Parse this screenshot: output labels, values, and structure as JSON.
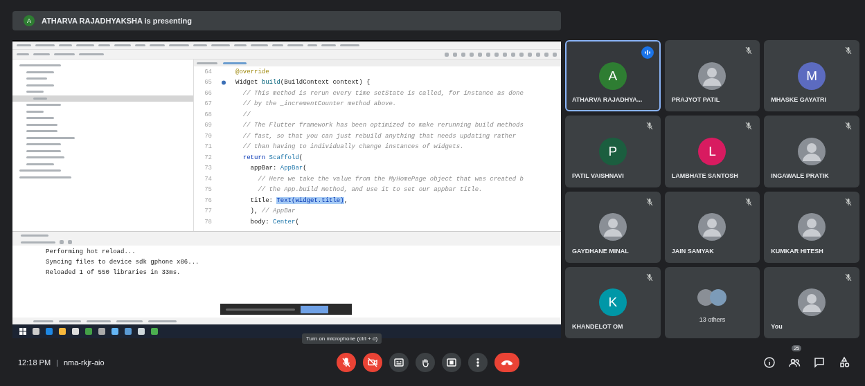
{
  "presenter_bar": {
    "initial": "A",
    "text": "ATHARVA RAJADHYAKSHA is presenting"
  },
  "shared_screen": {
    "editor": {
      "lines": [
        {
          "num": "64",
          "marker": false,
          "segments": [
            {
              "kind": "annotation",
              "text": "@override"
            }
          ]
        },
        {
          "num": "65",
          "marker": true,
          "segments": [
            {
              "kind": "code",
              "text": "Widget "
            },
            {
              "kind": "method",
              "text": "build"
            },
            {
              "kind": "code",
              "text": "(BuildContext context) {"
            }
          ]
        },
        {
          "num": "66",
          "marker": false,
          "segments": [
            {
              "kind": "comment",
              "text": "  // This method is rerun every time setState is called, for instance as done"
            }
          ]
        },
        {
          "num": "67",
          "marker": false,
          "segments": [
            {
              "kind": "comment",
              "text": "  // by the _incrementCounter method above."
            }
          ]
        },
        {
          "num": "68",
          "marker": false,
          "segments": [
            {
              "kind": "comment",
              "text": "  //"
            }
          ]
        },
        {
          "num": "69",
          "marker": false,
          "segments": [
            {
              "kind": "comment",
              "text": "  // The Flutter framework has been optimized to make rerunning build methods"
            }
          ]
        },
        {
          "num": "70",
          "marker": false,
          "segments": [
            {
              "kind": "comment",
              "text": "  // fast, so that you can just rebuild anything that needs updating rather"
            }
          ]
        },
        {
          "num": "71",
          "marker": false,
          "segments": [
            {
              "kind": "comment",
              "text": "  // than having to individually change instances of widgets."
            }
          ]
        },
        {
          "num": "72",
          "marker": false,
          "segments": [
            {
              "kind": "keyword",
              "text": "  return "
            },
            {
              "kind": "class",
              "text": "Scaffold"
            },
            {
              "kind": "code",
              "text": "("
            }
          ]
        },
        {
          "num": "73",
          "marker": false,
          "segments": [
            {
              "kind": "code",
              "text": "    appBar: "
            },
            {
              "kind": "class",
              "text": "AppBar"
            },
            {
              "kind": "code",
              "text": "("
            }
          ]
        },
        {
          "num": "74",
          "marker": false,
          "segments": [
            {
              "kind": "comment",
              "text": "      // Here we take the value from the MyHomePage object that was created b"
            }
          ]
        },
        {
          "num": "75",
          "marker": false,
          "segments": [
            {
              "kind": "comment",
              "text": "      // the App.build method, and use it to set our appbar title."
            }
          ]
        },
        {
          "num": "76",
          "marker": false,
          "segments": [
            {
              "kind": "code",
              "text": "    title: "
            },
            {
              "kind": "selection",
              "text": "Text(widget.title)"
            },
            {
              "kind": "code",
              "text": ","
            }
          ]
        },
        {
          "num": "77",
          "marker": false,
          "segments": [
            {
              "kind": "code",
              "text": "    ), "
            },
            {
              "kind": "comment",
              "text": "// AppBar"
            }
          ]
        },
        {
          "num": "78",
          "marker": false,
          "segments": [
            {
              "kind": "code",
              "text": "    body: "
            },
            {
              "kind": "class",
              "text": "Center"
            },
            {
              "kind": "code",
              "text": "("
            }
          ]
        }
      ]
    },
    "console": [
      "Performing hot reload...",
      "Syncing files to device sdk gphone x86...",
      "Reloaded 1 of 550 libraries in 33ms."
    ]
  },
  "participants": [
    {
      "name": "ATHARVA RAJADHYA...",
      "kind": "initial",
      "initial": "A",
      "color": "#2e7d32",
      "speaking": true,
      "muted": false
    },
    {
      "name": "PRAJYOT PATIL",
      "kind": "photo",
      "speaking": false,
      "muted": true
    },
    {
      "name": "MHASKE GAYATRI",
      "kind": "initial",
      "initial": "M",
      "color": "#5c6bc0",
      "speaking": false,
      "muted": true
    },
    {
      "name": "PATIL VAISHNAVI",
      "kind": "initial",
      "initial": "P",
      "color": "#1b5e3f",
      "speaking": false,
      "muted": true
    },
    {
      "name": "LAMBHATE SANTOSH",
      "kind": "initial",
      "initial": "L",
      "color": "#d81b60",
      "speaking": false,
      "muted": true
    },
    {
      "name": "INGAWALE PRATIK",
      "kind": "photo",
      "speaking": false,
      "muted": true
    },
    {
      "name": "GAYDHANE MINAL",
      "kind": "photo",
      "speaking": false,
      "muted": true
    },
    {
      "name": "JAIN SAMYAK",
      "kind": "photo",
      "speaking": false,
      "muted": true
    },
    {
      "name": "KUMKAR HITESH",
      "kind": "photo",
      "speaking": false,
      "muted": true
    },
    {
      "name": "KHANDELOT OM",
      "kind": "initial",
      "initial": "K",
      "color": "#0097a7",
      "speaking": false,
      "muted": true
    },
    {
      "name": "13 others",
      "kind": "others",
      "speaking": false,
      "muted": false
    },
    {
      "name": "You",
      "kind": "photo",
      "speaking": false,
      "muted": true
    }
  ],
  "tooltip": "Turn on microphone (ctrl + d)",
  "meeting_info": {
    "time": "12:18 PM",
    "separator": "|",
    "code": "nma-rkjr-aio"
  },
  "controls": [
    {
      "kind": "mic",
      "on": false
    },
    {
      "kind": "camera",
      "on": false
    },
    {
      "kind": "captions"
    },
    {
      "kind": "hand"
    },
    {
      "kind": "present"
    },
    {
      "kind": "more"
    },
    {
      "kind": "hangup"
    }
  ],
  "side_controls": [
    {
      "kind": "info"
    },
    {
      "kind": "people",
      "badge": "25"
    },
    {
      "kind": "chat"
    },
    {
      "kind": "activities"
    }
  ]
}
